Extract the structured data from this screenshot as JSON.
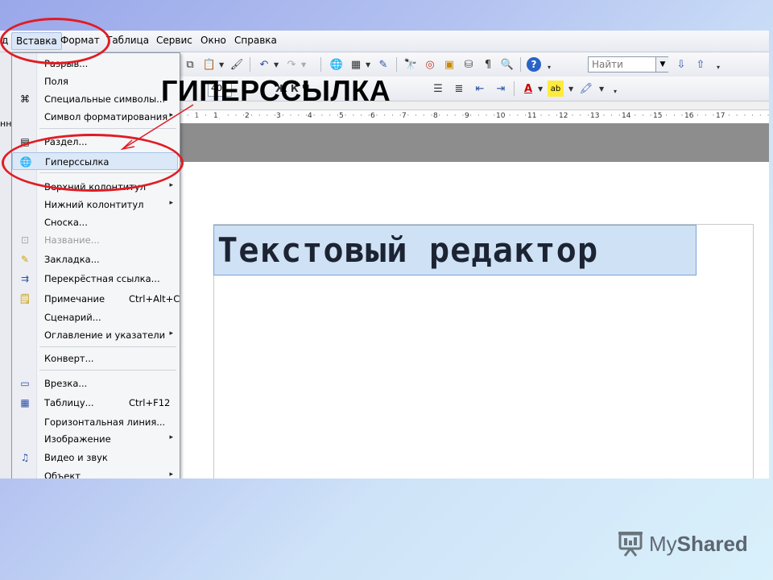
{
  "menubar": {
    "items": [
      "д",
      "Вставка",
      "Формат",
      "Таблица",
      "Сервис",
      "Окно",
      "Справка"
    ]
  },
  "toolbar": {
    "find_placeholder": "Найти",
    "font_size": "40",
    "tb2_fragment": "Ж К Ч"
  },
  "ruler": {
    "numbers": [
      "1",
      "2",
      "3",
      "4",
      "5",
      "6",
      "7",
      "8",
      "9",
      "10",
      "11",
      "12",
      "13",
      "14",
      "15",
      "16",
      "17"
    ]
  },
  "document": {
    "selected_text": "Текстовый редактор"
  },
  "left_edge": {
    "label": "нн"
  },
  "insert_menu": {
    "items": [
      {
        "label": "Разрыв...",
        "icon": "",
        "submenu": false,
        "disabled": false
      },
      {
        "label": "Поля",
        "icon": "",
        "submenu": false,
        "disabled": false
      },
      {
        "label": "Специальные символы...",
        "icon": "special-chars-icon",
        "submenu": false,
        "disabled": false
      },
      {
        "label": "Символ форматирования",
        "icon": "",
        "submenu": true,
        "disabled": false
      },
      {
        "label": "Раздел...",
        "icon": "section-icon",
        "submenu": false,
        "disabled": false
      },
      {
        "label": "Гиперссылка",
        "icon": "hyperlink-icon",
        "submenu": false,
        "disabled": false,
        "highlighted": true
      },
      {
        "label": "Верхний колонтитул",
        "icon": "",
        "submenu": true,
        "disabled": false
      },
      {
        "label": "Нижний колонтитул",
        "icon": "",
        "submenu": true,
        "disabled": false
      },
      {
        "label": "Сноска...",
        "icon": "",
        "submenu": false,
        "disabled": false
      },
      {
        "label": "Название...",
        "icon": "caption-icon",
        "submenu": false,
        "disabled": true
      },
      {
        "label": "Закладка...",
        "icon": "bookmark-icon",
        "submenu": false,
        "disabled": false
      },
      {
        "label": "Перекрёстная ссылка...",
        "icon": "cross-reference-icon",
        "submenu": false,
        "disabled": false
      },
      {
        "label": "Примечание",
        "shortcut": "Ctrl+Alt+C",
        "icon": "comment-icon",
        "submenu": false,
        "disabled": false
      },
      {
        "label": "Сценарий...",
        "icon": "",
        "submenu": false,
        "disabled": false
      },
      {
        "label": "Оглавление и указатели",
        "icon": "",
        "submenu": true,
        "disabled": false
      },
      {
        "label": "Конверт...",
        "icon": "",
        "submenu": false,
        "disabled": false
      },
      {
        "label": "Врезка...",
        "icon": "frame-icon",
        "submenu": false,
        "disabled": false
      },
      {
        "label": "Таблицу...",
        "shortcut": "Ctrl+F12",
        "icon": "table-icon",
        "submenu": false,
        "disabled": false
      },
      {
        "label": "Горизонтальная линия...",
        "icon": "",
        "submenu": false,
        "disabled": false
      },
      {
        "label": "Изображение",
        "icon": "",
        "submenu": true,
        "disabled": false
      },
      {
        "label": "Видео и звук",
        "icon": "media-icon",
        "submenu": false,
        "disabled": false
      },
      {
        "label": "Объект",
        "icon": "",
        "submenu": true,
        "disabled": false
      }
    ]
  },
  "annotation": {
    "callout_text": "ГИПЕРССЫЛКА",
    "highlight_color": "#e01c24"
  },
  "brand": {
    "name_regular": "My",
    "name_bold": "Shared"
  }
}
